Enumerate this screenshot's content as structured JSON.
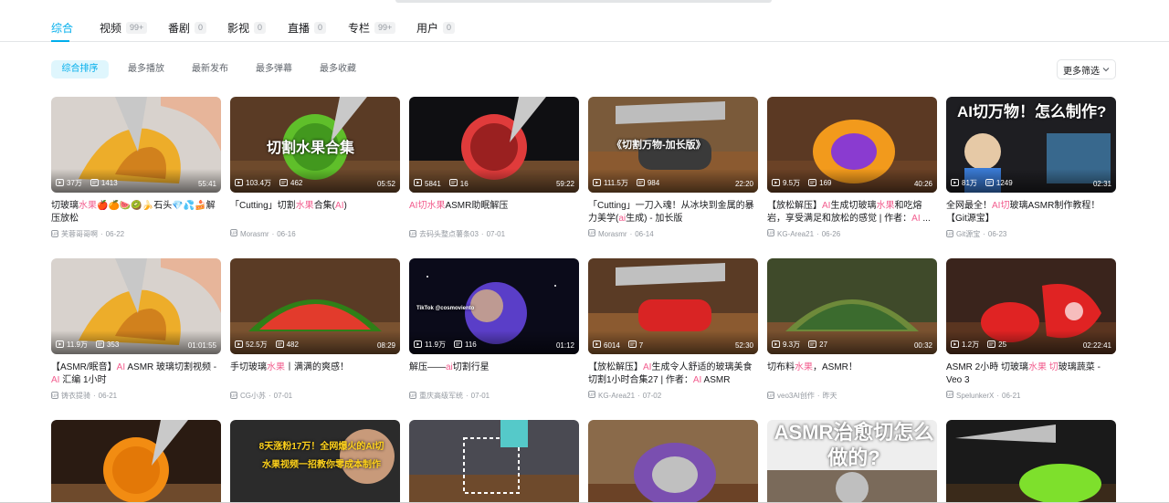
{
  "tabs": [
    {
      "label": "综合",
      "count": ""
    },
    {
      "label": "视频",
      "count": "99+"
    },
    {
      "label": "番剧",
      "count": "0"
    },
    {
      "label": "影视",
      "count": "0"
    },
    {
      "label": "直播",
      "count": "0"
    },
    {
      "label": "专栏",
      "count": "99+"
    },
    {
      "label": "用户",
      "count": "0"
    }
  ],
  "sorts": [
    "综合排序",
    "最多播放",
    "最新发布",
    "最多弹幕",
    "最多收藏"
  ],
  "more_filter": "更多筛选",
  "icons": {
    "play": "play-count-icon",
    "danmaku": "danmaku-icon",
    "uploader": "up-avatar-icon",
    "more": "chevron-down-icon"
  },
  "colors": {
    "accent": "#00aeec",
    "highlight": "#f25d8e"
  },
  "videos": [
    {
      "plays": "37万",
      "danmaku": "1413",
      "duration": "55:41",
      "title_parts": [
        "切玻璃",
        "水果",
        "🍎🍊🍉🥝🍌石头💎💦🍰解压放松"
      ],
      "uploader": "芙蓉哥哥啊",
      "date": "06-22",
      "overlay": ""
    },
    {
      "plays": "103.4万",
      "danmaku": "462",
      "duration": "05:52",
      "title_parts": [
        "「Cutting」切割",
        "水果",
        "合集(",
        "AI",
        ")"
      ],
      "uploader": "Morasmr",
      "date": "06-16",
      "overlay": "切割水果合集"
    },
    {
      "plays": "5841",
      "danmaku": "16",
      "duration": "59:22",
      "title_parts": [
        "",
        "AI切水果",
        "ASMR助眠解压"
      ],
      "uploader": "去码头整点薯条03",
      "date": "07-01",
      "overlay": ""
    },
    {
      "plays": "111.5万",
      "danmaku": "984",
      "duration": "22:20",
      "title_parts": [
        "「Cutting」一刀入魂！从冰块到金属的暴力美学(",
        "ai",
        "生成) - 加长版"
      ],
      "uploader": "Morasmr",
      "date": "06-14",
      "overlay": "《切割万物-加长版》"
    },
    {
      "plays": "9.5万",
      "danmaku": "169",
      "duration": "40:26",
      "title_parts": [
        "【放松解压】",
        "AI",
        "生成切玻璃",
        "水果",
        "和吃熔岩，享受满足和放松的感觉 | 作者：",
        "AI",
        " ..."
      ],
      "uploader": "KG-Area21",
      "date": "06-26",
      "overlay": ""
    },
    {
      "plays": "81万",
      "danmaku": "1249",
      "duration": "02:31",
      "title_parts": [
        "全网最全！",
        "AI切",
        "玻璃ASMR制作教程！【Git源宝】"
      ],
      "uploader": "Git源宝",
      "date": "06-23",
      "overlay": "AI切万物！怎么制作?"
    },
    {
      "plays": "11.9万",
      "danmaku": "353",
      "duration": "01:01:55",
      "title_parts": [
        "【ASMR/眠音】",
        "AI",
        " ASMR 玻璃切割视频 -",
        "AI",
        " 汇编 1小时"
      ],
      "uploader": "铸衣提骑",
      "date": "06-21",
      "overlay": ""
    },
    {
      "plays": "52.5万",
      "danmaku": "482",
      "duration": "08:29",
      "title_parts": [
        "手切玻璃",
        "水果",
        "丨满满的爽感！"
      ],
      "uploader": "CG小苏",
      "date": "07-01",
      "overlay": ""
    },
    {
      "plays": "11.9万",
      "danmaku": "116",
      "duration": "01:12",
      "title_parts": [
        "解压——",
        "ai",
        "切割行星"
      ],
      "uploader": "重庆高级军统",
      "date": "07-01",
      "overlay": "TikTok @cosmoviento"
    },
    {
      "plays": "6014",
      "danmaku": "7",
      "duration": "52:30",
      "title_parts": [
        "【放松解压】",
        "AI",
        "生成令人舒适的玻璃美食切割1小时合集27 | 作者：",
        "AI",
        " ASMR"
      ],
      "uploader": "KG-Area21",
      "date": "07-02",
      "overlay": ""
    },
    {
      "plays": "9.3万",
      "danmaku": "27",
      "duration": "00:32",
      "title_parts": [
        "切布料",
        "水果",
        "，ASMR！"
      ],
      "uploader": "veo3AI创作",
      "date": "昨天",
      "overlay": ""
    },
    {
      "plays": "1.2万",
      "danmaku": "25",
      "duration": "02:22:41",
      "title_parts": [
        "ASMR 2小時 切玻璃",
        "水果",
        " ",
        "切",
        "玻璃蔬菜 - Veo 3"
      ],
      "uploader": "SpelunkerX",
      "date": "06-21",
      "overlay": ""
    },
    {
      "overlay": ""
    },
    {
      "overlay": "8天涨粉17万！全网爆火的AI切水果视频一招教你零成本制作"
    },
    {
      "overlay": ""
    },
    {
      "overlay": ""
    },
    {
      "overlay": "ASMR治愈切怎么做的?"
    },
    {
      "overlay": ""
    }
  ]
}
